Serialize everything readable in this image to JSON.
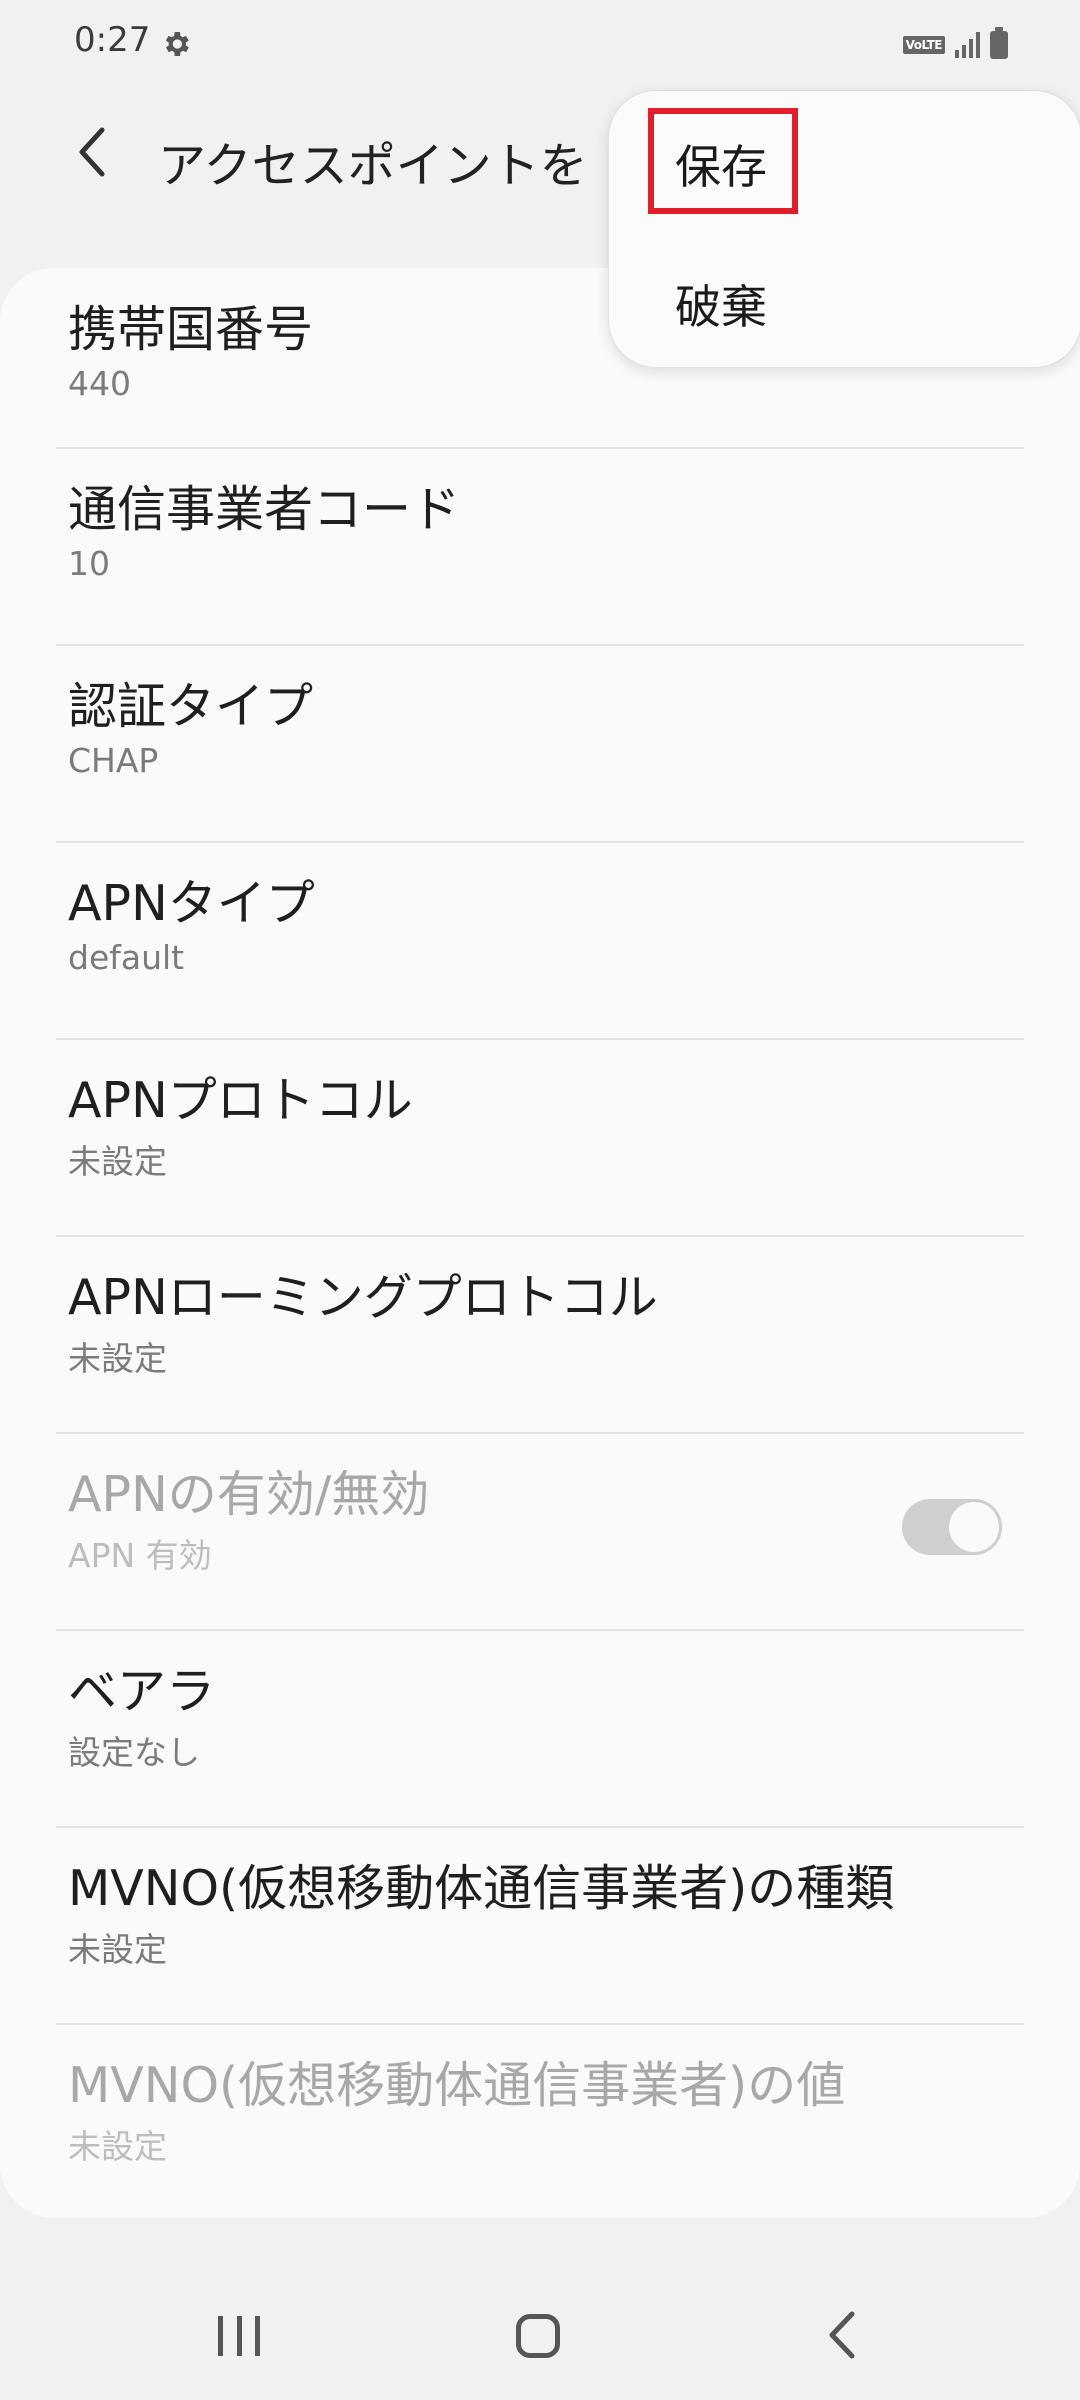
{
  "status_bar": {
    "time": "0:27",
    "icons": [
      "gear-icon",
      "volte-icon",
      "signal-icon",
      "battery-icon"
    ],
    "volte_label": "VoLTE"
  },
  "header": {
    "title": "アクセスポイントを",
    "back_icon": "chevron-left-icon"
  },
  "menu": {
    "save_label": "保存",
    "discard_label": "破棄",
    "highlight_color": "#e21e2a"
  },
  "settings": [
    {
      "title": "携帯国番号",
      "value": "440"
    },
    {
      "title": "通信事業者コード",
      "value": "10"
    },
    {
      "title": "認証タイプ",
      "value": "CHAP"
    },
    {
      "title": "APNタイプ",
      "value": "default"
    },
    {
      "title": "APNプロトコル",
      "value": "未設定"
    },
    {
      "title": "APNローミングプロトコル",
      "value": "未設定"
    },
    {
      "title": "APNの有効/無効",
      "value": "APN 有効",
      "disabled": true,
      "toggle_on": true
    },
    {
      "title": "ベアラ",
      "value": "設定なし"
    },
    {
      "title": "MVNO(仮想移動体通信事業者)の種類",
      "value": "未設定"
    },
    {
      "title": "MVNO(仮想移動体通信事業者)の値",
      "value": "未設定",
      "disabled": true
    }
  ],
  "nav_bar": {
    "icons": [
      "recents-icon",
      "home-icon",
      "back-icon"
    ]
  }
}
